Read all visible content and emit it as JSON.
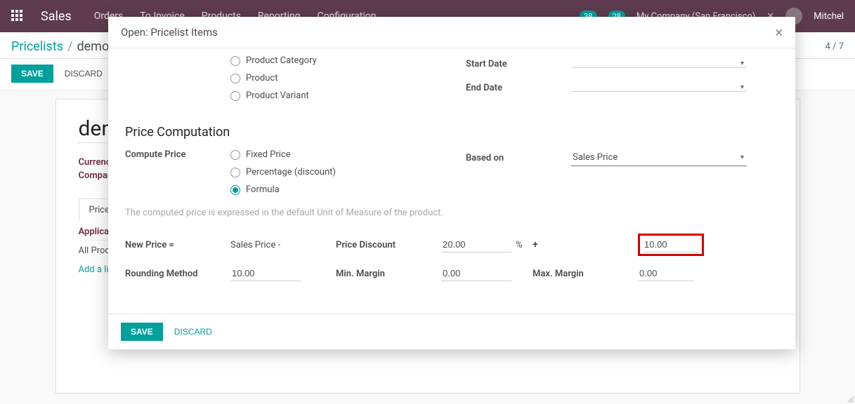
{
  "nav": {
    "brand": "Sales",
    "menu": [
      "Orders",
      "To Invoice",
      "Products",
      "Reporting",
      "Configuration"
    ],
    "badge1": "38",
    "badge2": "28",
    "company": "My Company (San Francisco)",
    "user": "Mitchel"
  },
  "breadcrumb": {
    "root": "Pricelists",
    "leaf": "demo"
  },
  "pager": "4 / 7",
  "actions": {
    "save": "SAVE",
    "discard": "DISCARD"
  },
  "sheet": {
    "title": "demo",
    "currency_label": "Currency",
    "company_label": "Company",
    "tab": "Price Rules",
    "col_applicable": "Applicable On",
    "row0": "All Products",
    "add_line": "Add a line"
  },
  "modal": {
    "title": "Open: Pricelist Items",
    "apply_on": {
      "options": {
        "category": "Product Category",
        "product": "Product",
        "variant": "Product Variant"
      }
    },
    "dates": {
      "start_label": "Start Date",
      "end_label": "End Date"
    },
    "section": "Price Computation",
    "compute": {
      "label": "Compute Price",
      "options": {
        "fixed": "Fixed Price",
        "percentage": "Percentage (discount)",
        "formula": "Formula"
      }
    },
    "based_on": {
      "label": "Based on",
      "value": "Sales Price"
    },
    "help": "The computed price is expressed in the default Unit of Measure of the product.",
    "formula": {
      "new_price_label": "New Price =",
      "base_text": "Sales Price -",
      "discount_label": "Price Discount",
      "discount_value": "20.00",
      "pct": "%",
      "plus": "+",
      "surcharge_value": "10.00",
      "rounding_label": "Rounding Method",
      "rounding_value": "10.00",
      "min_margin_label": "Min. Margin",
      "min_margin_value": "0.00",
      "max_margin_label": "Max. Margin",
      "max_margin_value": "0.00"
    },
    "footer": {
      "save": "SAVE",
      "discard": "DISCARD"
    }
  }
}
